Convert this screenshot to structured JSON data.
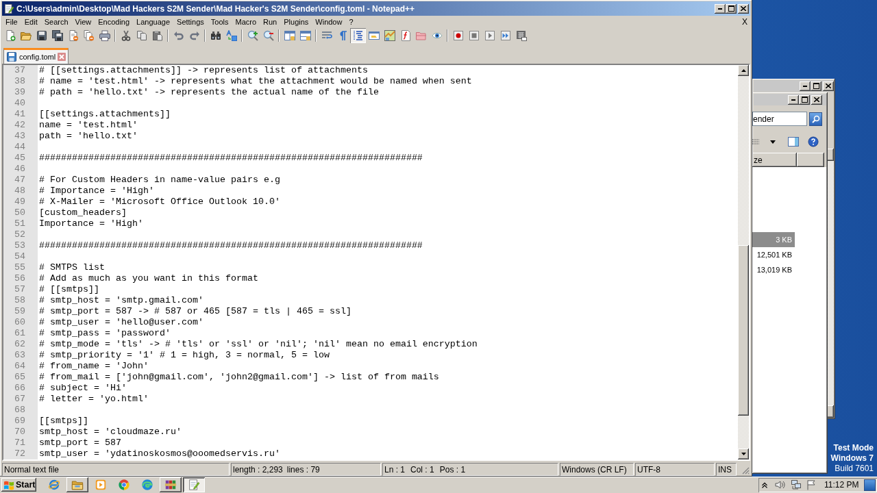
{
  "window": {
    "title": "C:\\Users\\admin\\Desktop\\Mad Hackers S2M Sender\\Mad Hacker's S2M Sender\\config.toml - Notepad++"
  },
  "menu": {
    "items": [
      "File",
      "Edit",
      "Search",
      "View",
      "Encoding",
      "Language",
      "Settings",
      "Tools",
      "Macro",
      "Run",
      "Plugins",
      "Window",
      "?"
    ],
    "close": "X"
  },
  "toolbar": [
    [
      {
        "kind": "new",
        "pressed": false
      },
      {
        "kind": "open",
        "pressed": false
      },
      {
        "kind": "save",
        "pressed": false
      },
      {
        "kind": "saveall",
        "pressed": false
      },
      {
        "kind": "close",
        "pressed": false
      },
      {
        "kind": "closeall",
        "pressed": false
      },
      {
        "kind": "print",
        "pressed": false
      }
    ],
    [
      {
        "kind": "cut",
        "pressed": false
      },
      {
        "kind": "copy",
        "pressed": false
      },
      {
        "kind": "paste",
        "pressed": false
      }
    ],
    [
      {
        "kind": "undo",
        "pressed": false
      },
      {
        "kind": "redo",
        "pressed": false
      }
    ],
    [
      {
        "kind": "find",
        "pressed": false
      },
      {
        "kind": "replace",
        "pressed": false
      }
    ],
    [
      {
        "kind": "zoomin",
        "pressed": false
      },
      {
        "kind": "zoomout",
        "pressed": false
      }
    ],
    [
      {
        "kind": "syncv",
        "pressed": false
      },
      {
        "kind": "synch",
        "pressed": false
      }
    ],
    [
      {
        "kind": "wrap",
        "pressed": false
      },
      {
        "kind": "allchars",
        "pressed": false
      },
      {
        "kind": "indent",
        "pressed": true
      },
      {
        "kind": "udl",
        "pressed": false
      },
      {
        "kind": "docmap",
        "pressed": false
      },
      {
        "kind": "funclist",
        "pressed": false
      },
      {
        "kind": "workspace",
        "pressed": false
      },
      {
        "kind": "monitor",
        "pressed": false
      }
    ],
    [
      {
        "kind": "record",
        "pressed": false
      },
      {
        "kind": "stop",
        "pressed": false
      },
      {
        "kind": "play",
        "pressed": false
      },
      {
        "kind": "playmulti",
        "pressed": false
      },
      {
        "kind": "savemacro",
        "pressed": false
      }
    ]
  ],
  "tabs": [
    {
      "label": "config.toml",
      "selected": true
    }
  ],
  "editor": {
    "lines": [
      {
        "number": "37",
        "text": "# [[settings.attachments]] -> represents list of attachments"
      },
      {
        "number": "38",
        "text": "# name = 'test.html' -> represents what the attachment would be named when sent"
      },
      {
        "number": "39",
        "text": "# path = 'hello.txt' -> represents the actual name of the file"
      },
      {
        "number": "40"
      },
      {
        "number": "41",
        "text": "[[settings.attachments]]"
      },
      {
        "number": "42",
        "text": "name = 'test.html'"
      },
      {
        "number": "43",
        "text": "path = 'hello.txt'"
      },
      {
        "number": "44"
      },
      {
        "number": "45",
        "text": "######################################################################"
      },
      {
        "number": "46"
      },
      {
        "number": "47",
        "text": "# For Custom Headers in name-value pairs e.g"
      },
      {
        "number": "48",
        "text": "# Importance = 'High'"
      },
      {
        "number": "49",
        "text": "# X-Mailer = 'Microsoft Office Outlook 10.0'"
      },
      {
        "number": "50",
        "text": "[custom_headers]"
      },
      {
        "number": "51",
        "text": "Importance = 'High'"
      },
      {
        "number": "52"
      },
      {
        "number": "53",
        "text": "######################################################################"
      },
      {
        "number": "54"
      },
      {
        "number": "55",
        "text": "# SMTPS list"
      },
      {
        "number": "56",
        "text": "# Add as much as you want in this format"
      },
      {
        "number": "57",
        "text": "# [[smtps]]"
      },
      {
        "number": "58",
        "text": "# smtp_host = 'smtp.gmail.com'"
      },
      {
        "number": "59",
        "text": "# smtp_port = 587 -> # 587 or 465 [587 = tls | 465 = ssl]"
      },
      {
        "number": "60",
        "text": "# smtp_user = 'hello@user.com'"
      },
      {
        "number": "61",
        "text": "# smtp_pass = 'password'"
      },
      {
        "number": "62",
        "text": "# smtp_mode = 'tls' -> # 'tls' or 'ssl' or 'nil'; 'nil' mean no email encryption"
      },
      {
        "number": "63",
        "text": "# smtp_priority = '1' # 1 = high, 3 = normal, 5 = low"
      },
      {
        "number": "64",
        "text": "# from_name = 'John'"
      },
      {
        "number": "65",
        "text": "# from_mail = ['john@gmail.com', 'john2@gmail.com'] -> list of from mails"
      },
      {
        "number": "66",
        "text": "# subject = 'Hi'"
      },
      {
        "number": "67",
        "text": "# letter = 'yo.html'"
      },
      {
        "number": "68"
      },
      {
        "number": "69",
        "text": "[[smtps]]"
      },
      {
        "number": "70",
        "text": "smtp_host = 'cloudmaze.ru'"
      },
      {
        "number": "71",
        "text": "smtp_port = 587"
      },
      {
        "number": "72",
        "text": "smtp_user = 'ydatinoskosmos@ooomedservis.ru'"
      }
    ]
  },
  "status_bar": {
    "document_type": "Normal text file",
    "length": "length : 2,293",
    "lines": "lines : 79",
    "line": "Ln : 1",
    "column": "Col : 1",
    "position": "Pos : 1",
    "line_ending": "Windows (CR LF)",
    "encoding": "UTF-8",
    "insert_mode": "INS"
  },
  "explorer": {
    "search_value": "ender",
    "column_header": "ze",
    "rows": [
      {
        "size": "3 KB",
        "selected": true
      },
      {
        "size": "12,501 KB",
        "selected": false
      },
      {
        "size": "13,019 KB",
        "selected": false
      }
    ]
  },
  "desktop_notice": {
    "mode": "Test Mode",
    "os": "Windows 7",
    "build": "Build 7601"
  },
  "taskbar": {
    "start": "Start",
    "apps": [
      {
        "kind": "ie",
        "open": false,
        "selected": false
      },
      {
        "kind": "folder",
        "open": true,
        "selected": false
      },
      {
        "kind": "player",
        "open": false,
        "selected": false
      },
      {
        "kind": "chrome",
        "open": false,
        "selected": false
      },
      {
        "kind": "edge",
        "open": false,
        "selected": false
      },
      {
        "kind": "archive",
        "open": true,
        "selected": false
      },
      {
        "kind": "notepad",
        "open": true,
        "selected": true
      }
    ],
    "clock": "11:12 PM"
  }
}
